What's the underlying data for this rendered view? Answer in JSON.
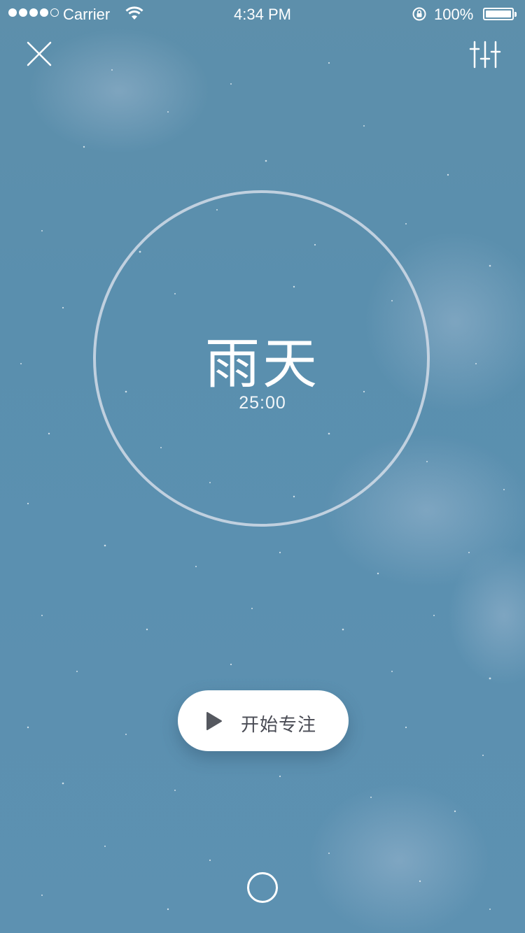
{
  "status_bar": {
    "carrier": "Carrier",
    "time": "4:34 PM",
    "battery": "100%",
    "signal_bars_filled": 4,
    "signal_bars_total": 5
  },
  "actions": {
    "close_icon": "close-icon",
    "settings_icon": "sliders-icon"
  },
  "scene": {
    "title": "雨天",
    "timer": "25:00"
  },
  "start_button": {
    "label": "开始专注",
    "icon": "play-icon"
  },
  "colors": {
    "background": "#5b90b0",
    "accent_text": "#4a4c55",
    "ring": "#d2dce8"
  }
}
